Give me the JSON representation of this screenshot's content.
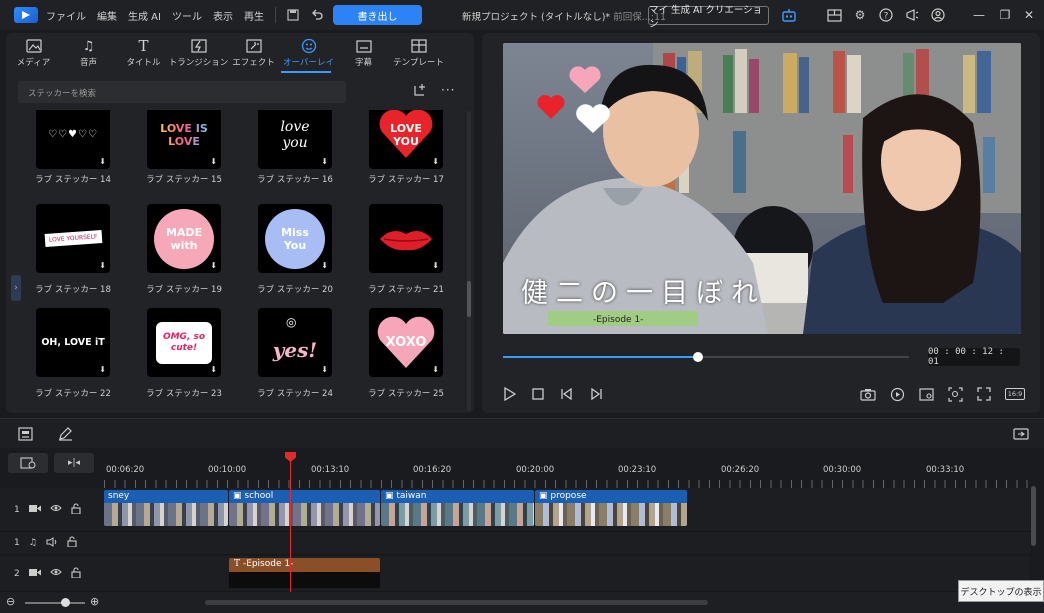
{
  "menu": [
    "ファイル",
    "編集",
    "生成 AI",
    "ツール",
    "表示",
    "再生"
  ],
  "export_label": "書き出し",
  "project_title": "新規プロジェクト (タイトルなし)*",
  "project_saved": "前回保...:11",
  "ai_creation_label": "マイ 生成 AI クリエーション",
  "tabs": [
    {
      "label": "メディア",
      "icon": "media-icon"
    },
    {
      "label": "音声",
      "icon": "music-note-icon"
    },
    {
      "label": "タイトル",
      "icon": "title-t-icon"
    },
    {
      "label": "トランジション",
      "icon": "transition-icon"
    },
    {
      "label": "エフェクト",
      "icon": "effect-icon"
    },
    {
      "label": "オーバーレイ",
      "icon": "overlay-icon"
    },
    {
      "label": "字幕",
      "icon": "subtitle-icon"
    },
    {
      "label": "テンプレート",
      "icon": "template-icon"
    }
  ],
  "active_tab": "オーバーレイ",
  "search_placeholder": "ステッカーを検索",
  "stickers": [
    {
      "label": "ラブ ステッカー 14",
      "art": "♡♡♥♡♡"
    },
    {
      "label": "ラブ ステッカー 15",
      "art": "LOVE IS LOVE"
    },
    {
      "label": "ラブ ステッカー 16",
      "art": "love you"
    },
    {
      "label": "ラブ ステッカー 17",
      "art": "LOVE YOU"
    },
    {
      "label": "ラブ ステッカー 18",
      "art": "LOVE YOURSELF"
    },
    {
      "label": "ラブ ステッカー 19",
      "art": "MADE with"
    },
    {
      "label": "ラブ ステッカー 20",
      "art": "Miss You"
    },
    {
      "label": "ラブ ステッカー 21",
      "art": "lips"
    },
    {
      "label": "ラブ ステッカー 22",
      "art": "OH, LOVE iT"
    },
    {
      "label": "ラブ ステッカー 23",
      "art": "OMG, so cute!"
    },
    {
      "label": "ラブ ステッカー 24",
      "art": "yes!"
    },
    {
      "label": "ラブ ステッカー 25",
      "art": "XOXO"
    }
  ],
  "preview": {
    "title_text": "健二の一目ぼれ",
    "episode_text": "-Episode 1-",
    "timecode": "00 : 00 : 12 : 01",
    "progress": 0.48,
    "aspect": "16:9"
  },
  "ruler_labels": [
    "00:06:20",
    "00:10:00",
    "00:13:10",
    "00:16:20",
    "00:20:00",
    "00:23:10",
    "00:26:20",
    "00:30:00",
    "00:33:10"
  ],
  "tracks": [
    {
      "number": "1",
      "type": "video"
    },
    {
      "number": "1",
      "type": "audio"
    },
    {
      "number": "2",
      "type": "video"
    }
  ],
  "clips": [
    "sney",
    "school",
    "taiwan",
    "propose"
  ],
  "text_clip": "-Episode 1-",
  "tooltip": "デスクトップの表示",
  "colors": {
    "accent": "#2b83f6",
    "playhead": "#e02b2b",
    "clip": "#1b5fb5",
    "text_clip": "#8a4f27"
  }
}
